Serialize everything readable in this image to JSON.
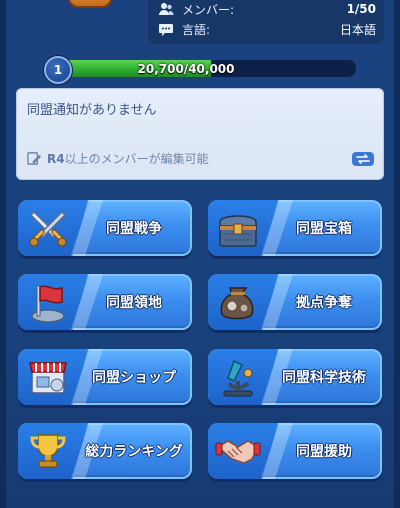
{
  "info": {
    "members_label": "メンバー:",
    "members_value": "1/50",
    "language_label": "言語:",
    "language_value": "日本語"
  },
  "level": {
    "value": "1",
    "progress_text": "20,700/40,000",
    "progress_fraction": 0.5175
  },
  "notice": {
    "message": "同盟通知がありません",
    "rank_tag": "R4",
    "edit_hint": "以上のメンバーが編集可能"
  },
  "menu": [
    {
      "label": "同盟戦争",
      "icon": "crossed-swords-icon"
    },
    {
      "label": "同盟宝箱",
      "icon": "treasure-chest-icon"
    },
    {
      "label": "同盟領地",
      "icon": "red-flag-icon"
    },
    {
      "label": "拠点争奪",
      "icon": "sack-icon"
    },
    {
      "label": "同盟ショップ",
      "icon": "shop-icon"
    },
    {
      "label": "同盟科学技術",
      "icon": "microscope-icon"
    },
    {
      "label": "総力ランキング",
      "icon": "trophy-icon"
    },
    {
      "label": "同盟援助",
      "icon": "handshake-icon"
    }
  ],
  "colors": {
    "background": "#1a3e78",
    "button": "#3c8ff0",
    "progress": "#2fae32"
  }
}
